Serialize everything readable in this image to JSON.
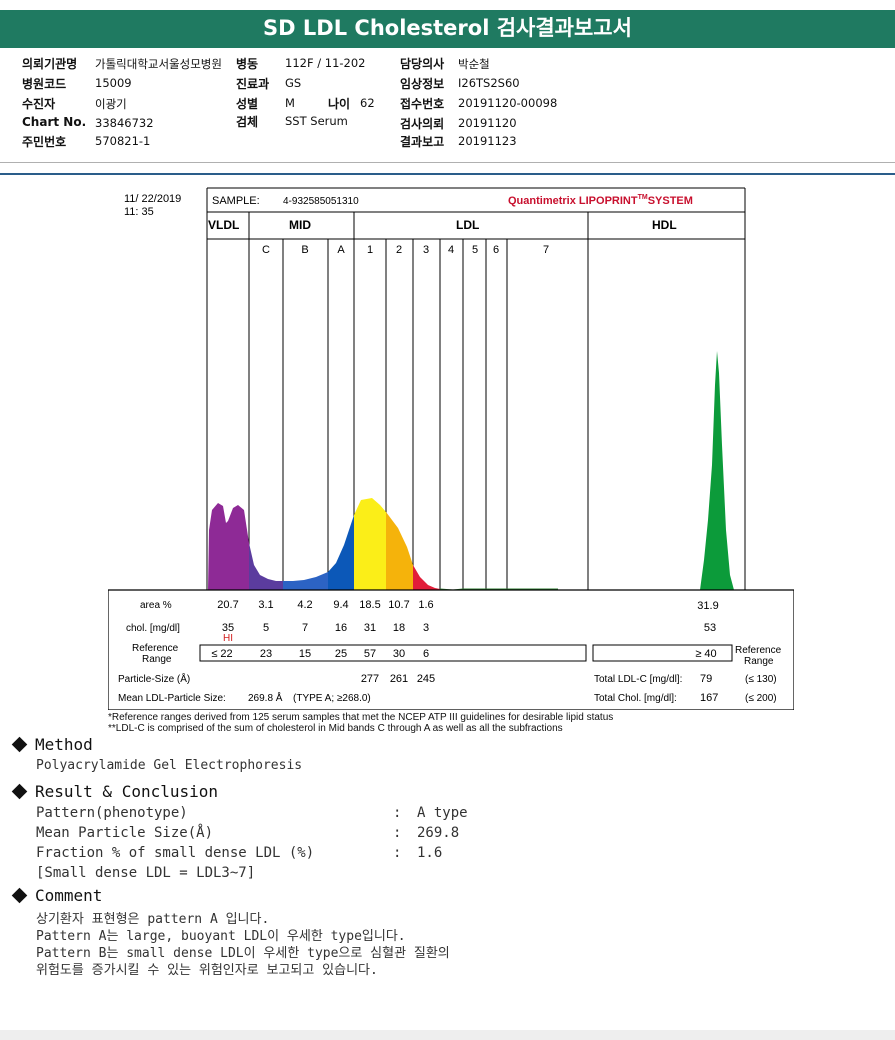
{
  "report": {
    "title": "SD LDL Cholesterol 검사결과보고서"
  },
  "header_fields": {
    "ordering_institution_label": "의뢰기관명",
    "ordering_institution_value": "가톨릭대학교서울성모병원",
    "ward_label": "병동",
    "ward_value": "112F / 11-202",
    "physician_label": "담당의사",
    "physician_value": "박순철",
    "hospital_code_label": "병원코드",
    "hospital_code_value": "15009",
    "department_label": "진료과",
    "department_value": "GS",
    "clinical_info_label": "임상정보",
    "clinical_info_value": "I26TS2S60",
    "patient_label": "수진자",
    "patient_value": "이광기",
    "sex_label": "성별",
    "sex_value": "M",
    "age_label": "나이",
    "age_value": "62",
    "accession_label": "접수번호",
    "accession_value": "20191120-00098",
    "chart_no_label": "Chart No.",
    "chart_no_value": "33846732",
    "specimen_label": "검체",
    "specimen_value": "SST Serum",
    "request_date_label": "검사의뢰",
    "request_date_value": "20191120",
    "resident_no_label": "주민번호",
    "resident_no_value": "570821-1",
    "report_date_label": "결과보고",
    "report_date_value": "20191123"
  },
  "lipoprint": {
    "date": "11/ 22/2019",
    "time": "11: 35",
    "sample_label": "SAMPLE:",
    "sample_id": "4-932585051310",
    "brand": "Quantimetrix LIPOPRINT",
    "brand_tm": "TM",
    "brand_suffix": "SYSTEM",
    "groups": [
      "VLDL",
      "MID",
      "LDL",
      "HDL"
    ],
    "bands": [
      "C",
      "B",
      "A",
      "1",
      "2",
      "3",
      "4",
      "5",
      "6",
      "7"
    ],
    "row_labels": {
      "area": "area %",
      "chol": "chol. [mg/dl]",
      "ref": "Reference Range",
      "psize": "Particle-Size (Å)",
      "mean": "Mean LDL-Particle Size:",
      "mean_val": "269.8 Å",
      "mean_type": "(TYPE A; ≥268.0)"
    },
    "area_values": [
      "20.7",
      "3.1",
      "4.2",
      "9.4",
      "18.5",
      "10.7",
      "1.6"
    ],
    "hdl_area": "31.9",
    "chol_values": [
      "35",
      "5",
      "7",
      "16",
      "31",
      "18",
      "3"
    ],
    "hdl_chol": "53",
    "hi_flag": "HI",
    "ref_values": [
      "≤ 22",
      "23",
      "15",
      "25",
      "57",
      "30",
      "6"
    ],
    "hdl_ref": "≥ 40",
    "ref_right_label": "Reference Range",
    "particle_sizes": [
      "277",
      "261",
      "245"
    ],
    "total_ldl_label": "Total LDL-C [mg/dl]:",
    "total_ldl_value": "79",
    "total_ldl_ref": "(≤ 130)",
    "total_chol_label": "Total Chol. [mg/dl]:",
    "total_chol_value": "167",
    "total_chol_ref": "(≤ 200)"
  },
  "chart_data": {
    "type": "area",
    "title": "",
    "xlabel": "",
    "ylabel": "",
    "categories": [
      "VLDL",
      "MID C",
      "MID B",
      "MID A",
      "LDL 1",
      "LDL 2",
      "LDL 3",
      "LDL 4",
      "LDL 5",
      "LDL 6",
      "LDL 7",
      "HDL"
    ],
    "series": [
      {
        "values": [
          20.7,
          3.1,
          4.2,
          9.4,
          18.5,
          10.7,
          1.6,
          0,
          0,
          0,
          0,
          31.9
        ]
      }
    ],
    "colors": {
      "VLDL": "#8e2a96",
      "MID C": "#5b3c9e",
      "MID B": "#2c63c4",
      "MID A": "#0c58b8",
      "LDL 1": "#fbee18",
      "LDL 2": "#f5b30b",
      "LDL 3": "#e21d39",
      "HDL": "#0c9b3a"
    }
  },
  "footnotes": [
    "*Reference ranges derived from 125 serum samples that met the NCEP ATP III guidelines for desirable lipid status",
    "**LDL-C is comprised of the sum of cholesterol in Mid bands C through A as well as all the subfractions"
  ],
  "method": {
    "heading": "Method",
    "text": "Polyacrylamide Gel Electrophoresis"
  },
  "result": {
    "heading": "Result & Conclusion",
    "rows": [
      {
        "label": "Pattern(phenotype)",
        "value": "A type"
      },
      {
        "label": "Mean Particle Size(Å)",
        "value": "269.8"
      },
      {
        "label": "Fraction % of small dense LDL (%)",
        "value": "1.6"
      }
    ],
    "separator": ":",
    "note": "[Small dense LDL = LDL3~7]"
  },
  "comment": {
    "heading": "Comment",
    "lines": [
      "상기환자 표현형은 pattern A 입니다.",
      "Pattern A는 large, buoyant LDL이 우세한 type입니다.",
      "Pattern B는 small dense LDL이 우세한 type으로 심혈관 질환의",
      "위험도를 증가시킬 수 있는 위험인자로 보고되고 있습니다."
    ]
  }
}
